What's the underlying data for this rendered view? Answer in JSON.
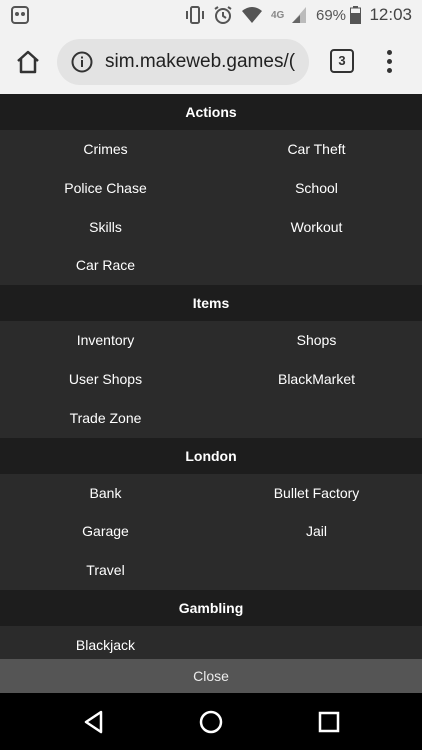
{
  "status_bar": {
    "battery": "69%",
    "time": "12:03",
    "network": "4G"
  },
  "address_bar": {
    "url": "sim.makeweb.games/(",
    "tab_count": "3"
  },
  "menu": {
    "sections": [
      {
        "title": "Actions",
        "items": [
          "Crimes",
          "Car Theft",
          "Police Chase",
          "School",
          "Skills",
          "Workout",
          "Car Race"
        ]
      },
      {
        "title": "Items",
        "items": [
          "Inventory",
          "Shops",
          "User Shops",
          "BlackMarket",
          "Trade Zone"
        ]
      },
      {
        "title": "London",
        "items": [
          "Bank",
          "Bullet Factory",
          "Garage",
          "Jail",
          "Travel"
        ]
      },
      {
        "title": "Gambling",
        "items": [
          "Blackjack"
        ]
      }
    ],
    "close_label": "Close"
  },
  "icons": {
    "home": "home-icon",
    "info": "info-icon",
    "overflow": "overflow-menu-icon",
    "back": "back-icon",
    "home_nav": "home-nav-icon",
    "recents": "recents-icon"
  }
}
